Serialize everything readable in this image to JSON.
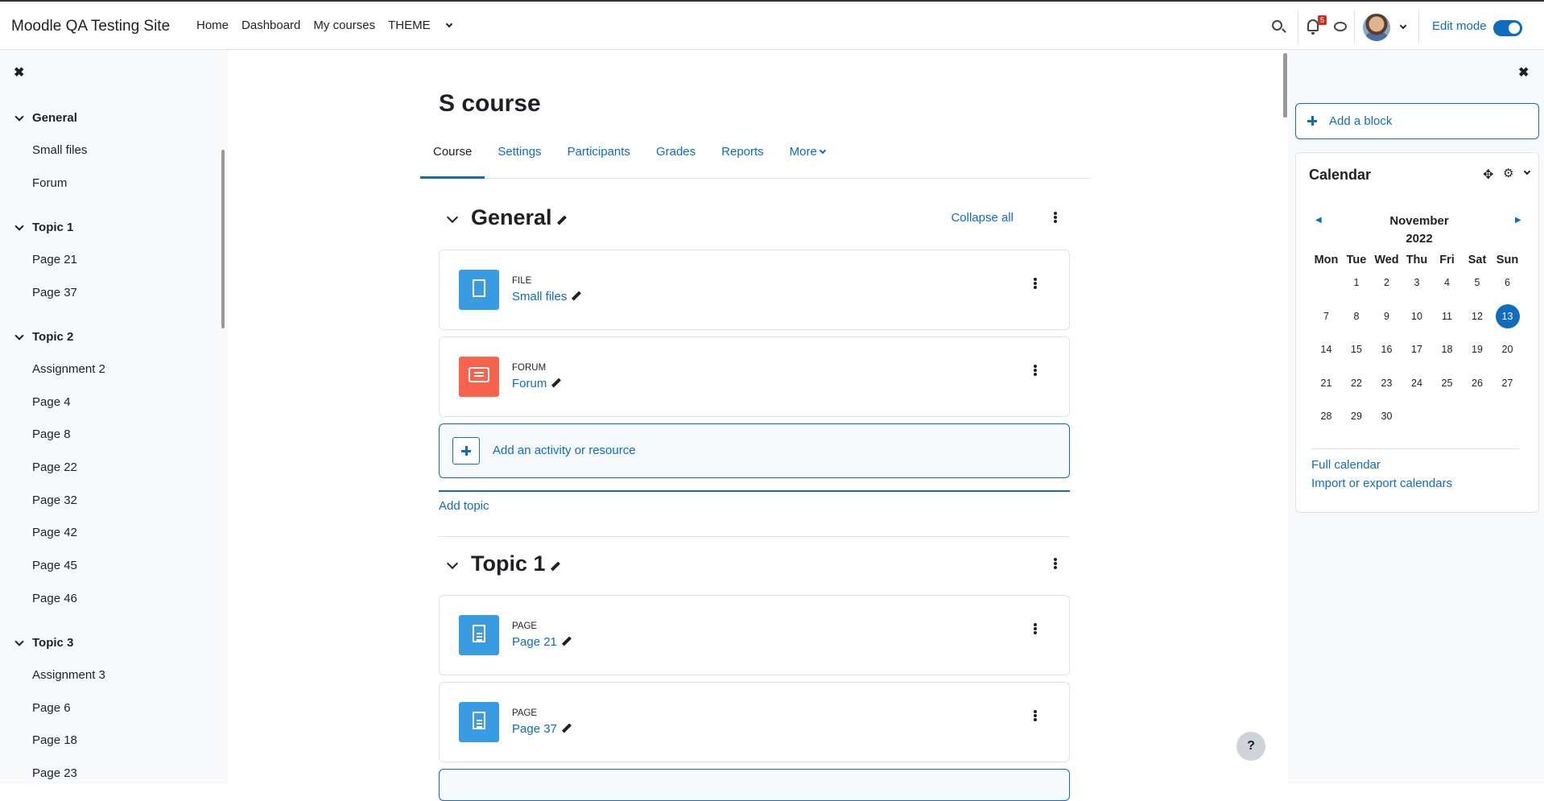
{
  "site": {
    "brand": "Moodle QA Testing Site"
  },
  "primary_nav": [
    "Home",
    "Dashboard",
    "My courses",
    "THEME"
  ],
  "notifications": {
    "count": "5"
  },
  "edit_mode": {
    "label": "Edit mode",
    "enabled": true
  },
  "course_index": {
    "sections": [
      {
        "title": "General",
        "items": [
          "Small files",
          "Forum"
        ]
      },
      {
        "title": "Topic 1",
        "items": [
          "Page 21",
          "Page 37"
        ]
      },
      {
        "title": "Topic 2",
        "items": [
          "Assignment 2",
          "Page 4",
          "Page 8",
          "Page 22",
          "Page 32",
          "Page 42",
          "Page 45",
          "Page 46"
        ]
      },
      {
        "title": "Topic 3",
        "items": [
          "Assignment 3",
          "Page 6",
          "Page 18",
          "Page 23"
        ]
      }
    ]
  },
  "course": {
    "title": "S course",
    "tabs": [
      "Course",
      "Settings",
      "Participants",
      "Grades",
      "Reports",
      "More"
    ],
    "collapse_all": "Collapse all",
    "add_activity": "Add an activity or resource",
    "add_topic": "Add topic",
    "sections": [
      {
        "title": "General",
        "activities": [
          {
            "type": "FILE",
            "name": "Small files",
            "icon": "file-icon"
          },
          {
            "type": "FORUM",
            "name": "Forum",
            "icon": "forum-icon"
          }
        ]
      },
      {
        "title": "Topic 1",
        "activities": [
          {
            "type": "PAGE",
            "name": "Page 21",
            "icon": "page-icon"
          },
          {
            "type": "PAGE",
            "name": "Page 37",
            "icon": "page-icon"
          }
        ]
      }
    ]
  },
  "blocks": {
    "add_block": "Add a block",
    "calendar": {
      "title": "Calendar",
      "month": "November",
      "year": "2022",
      "weekdays": [
        "Mon",
        "Tue",
        "Wed",
        "Thu",
        "Fri",
        "Sat",
        "Sun"
      ],
      "weeks": [
        [
          "",
          "1",
          "2",
          "3",
          "4",
          "5",
          "6"
        ],
        [
          "7",
          "8",
          "9",
          "10",
          "11",
          "12",
          "13"
        ],
        [
          "14",
          "15",
          "16",
          "17",
          "18",
          "19",
          "20"
        ],
        [
          "21",
          "22",
          "23",
          "24",
          "25",
          "26",
          "27"
        ],
        [
          "28",
          "29",
          "30",
          "",
          "",
          "",
          ""
        ]
      ],
      "today": "13",
      "links": [
        "Full calendar",
        "Import or export calendars"
      ]
    }
  },
  "help": {
    "label": "?"
  },
  "colors": {
    "accent": "#0f6cbf",
    "file": "#399be2",
    "forum": "#f7634d",
    "badge": "#ca3120"
  }
}
